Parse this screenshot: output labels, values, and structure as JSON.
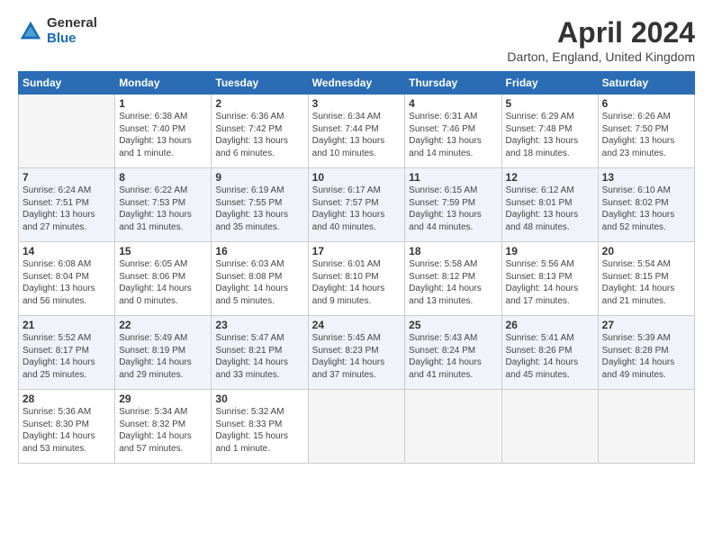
{
  "logo": {
    "general": "General",
    "blue": "Blue"
  },
  "title": "April 2024",
  "location": "Darton, England, United Kingdom",
  "headers": [
    "Sunday",
    "Monday",
    "Tuesday",
    "Wednesday",
    "Thursday",
    "Friday",
    "Saturday"
  ],
  "weeks": [
    [
      {
        "day": "",
        "info": ""
      },
      {
        "day": "1",
        "info": "Sunrise: 6:38 AM\nSunset: 7:40 PM\nDaylight: 13 hours\nand 1 minute."
      },
      {
        "day": "2",
        "info": "Sunrise: 6:36 AM\nSunset: 7:42 PM\nDaylight: 13 hours\nand 6 minutes."
      },
      {
        "day": "3",
        "info": "Sunrise: 6:34 AM\nSunset: 7:44 PM\nDaylight: 13 hours\nand 10 minutes."
      },
      {
        "day": "4",
        "info": "Sunrise: 6:31 AM\nSunset: 7:46 PM\nDaylight: 13 hours\nand 14 minutes."
      },
      {
        "day": "5",
        "info": "Sunrise: 6:29 AM\nSunset: 7:48 PM\nDaylight: 13 hours\nand 18 minutes."
      },
      {
        "day": "6",
        "info": "Sunrise: 6:26 AM\nSunset: 7:50 PM\nDaylight: 13 hours\nand 23 minutes."
      }
    ],
    [
      {
        "day": "7",
        "info": "Sunrise: 6:24 AM\nSunset: 7:51 PM\nDaylight: 13 hours\nand 27 minutes."
      },
      {
        "day": "8",
        "info": "Sunrise: 6:22 AM\nSunset: 7:53 PM\nDaylight: 13 hours\nand 31 minutes."
      },
      {
        "day": "9",
        "info": "Sunrise: 6:19 AM\nSunset: 7:55 PM\nDaylight: 13 hours\nand 35 minutes."
      },
      {
        "day": "10",
        "info": "Sunrise: 6:17 AM\nSunset: 7:57 PM\nDaylight: 13 hours\nand 40 minutes."
      },
      {
        "day": "11",
        "info": "Sunrise: 6:15 AM\nSunset: 7:59 PM\nDaylight: 13 hours\nand 44 minutes."
      },
      {
        "day": "12",
        "info": "Sunrise: 6:12 AM\nSunset: 8:01 PM\nDaylight: 13 hours\nand 48 minutes."
      },
      {
        "day": "13",
        "info": "Sunrise: 6:10 AM\nSunset: 8:02 PM\nDaylight: 13 hours\nand 52 minutes."
      }
    ],
    [
      {
        "day": "14",
        "info": "Sunrise: 6:08 AM\nSunset: 8:04 PM\nDaylight: 13 hours\nand 56 minutes."
      },
      {
        "day": "15",
        "info": "Sunrise: 6:05 AM\nSunset: 8:06 PM\nDaylight: 14 hours\nand 0 minutes."
      },
      {
        "day": "16",
        "info": "Sunrise: 6:03 AM\nSunset: 8:08 PM\nDaylight: 14 hours\nand 5 minutes."
      },
      {
        "day": "17",
        "info": "Sunrise: 6:01 AM\nSunset: 8:10 PM\nDaylight: 14 hours\nand 9 minutes."
      },
      {
        "day": "18",
        "info": "Sunrise: 5:58 AM\nSunset: 8:12 PM\nDaylight: 14 hours\nand 13 minutes."
      },
      {
        "day": "19",
        "info": "Sunrise: 5:56 AM\nSunset: 8:13 PM\nDaylight: 14 hours\nand 17 minutes."
      },
      {
        "day": "20",
        "info": "Sunrise: 5:54 AM\nSunset: 8:15 PM\nDaylight: 14 hours\nand 21 minutes."
      }
    ],
    [
      {
        "day": "21",
        "info": "Sunrise: 5:52 AM\nSunset: 8:17 PM\nDaylight: 14 hours\nand 25 minutes."
      },
      {
        "day": "22",
        "info": "Sunrise: 5:49 AM\nSunset: 8:19 PM\nDaylight: 14 hours\nand 29 minutes."
      },
      {
        "day": "23",
        "info": "Sunrise: 5:47 AM\nSunset: 8:21 PM\nDaylight: 14 hours\nand 33 minutes."
      },
      {
        "day": "24",
        "info": "Sunrise: 5:45 AM\nSunset: 8:23 PM\nDaylight: 14 hours\nand 37 minutes."
      },
      {
        "day": "25",
        "info": "Sunrise: 5:43 AM\nSunset: 8:24 PM\nDaylight: 14 hours\nand 41 minutes."
      },
      {
        "day": "26",
        "info": "Sunrise: 5:41 AM\nSunset: 8:26 PM\nDaylight: 14 hours\nand 45 minutes."
      },
      {
        "day": "27",
        "info": "Sunrise: 5:39 AM\nSunset: 8:28 PM\nDaylight: 14 hours\nand 49 minutes."
      }
    ],
    [
      {
        "day": "28",
        "info": "Sunrise: 5:36 AM\nSunset: 8:30 PM\nDaylight: 14 hours\nand 53 minutes."
      },
      {
        "day": "29",
        "info": "Sunrise: 5:34 AM\nSunset: 8:32 PM\nDaylight: 14 hours\nand 57 minutes."
      },
      {
        "day": "30",
        "info": "Sunrise: 5:32 AM\nSunset: 8:33 PM\nDaylight: 15 hours\nand 1 minute."
      },
      {
        "day": "",
        "info": ""
      },
      {
        "day": "",
        "info": ""
      },
      {
        "day": "",
        "info": ""
      },
      {
        "day": "",
        "info": ""
      }
    ]
  ]
}
